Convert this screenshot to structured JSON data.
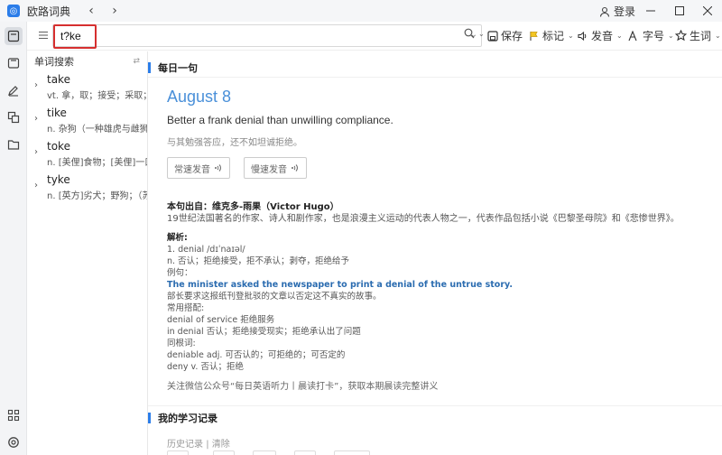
{
  "window": {
    "title": "欧路词典",
    "login": "登录"
  },
  "search": {
    "value": "t?ke",
    "toolbar": {
      "save": "保存",
      "mark": "标记",
      "pronounce": "发音",
      "font": "字号",
      "vocab": "生词"
    }
  },
  "wordlist": {
    "header": "单词搜索",
    "items": [
      {
        "word": "take",
        "def": "vt. 拿，取；接受；采取；吸"
      },
      {
        "word": "tike",
        "def": "n. 杂狗（一种雄虎与雌狮交"
      },
      {
        "word": "toke",
        "def": "n. [美俚]食物；[美俚]一口抽"
      },
      {
        "word": "tyke",
        "def": "n. [英方]劣犬；野狗；（苏"
      }
    ]
  },
  "daily": {
    "section_title": "每日一句",
    "date": "August 8",
    "sentence": "Better a frank denial than unwilling compliance.",
    "translation": "与其勉强答应，还不如坦诚拒绝。",
    "normal_audio": "常速发音",
    "slow_audio": "慢速发音",
    "source": "本句出自：维克多-雨果（Victor Hugo）",
    "bio": "19世纪法国著名的作家、诗人和剧作家，也是浪漫主义运动的代表人物之一，代表作品包括小说《巴黎圣母院》和《悲惨世界》。",
    "analysis_title": "解析:",
    "analysis": [
      "1. denial /dɪˈnaɪəl/",
      "n. 否认；拒绝接受，拒不承认；剥夺，拒绝给予",
      "例句：",
      "The minister asked the newspaper to print a denial of the untrue story.",
      "部长要求这报纸刊登批驳的文章以否定这不真实的故事。",
      "常用搭配:",
      "denial of service 拒绝服务",
      "in denial 否认；拒绝接受现实；拒绝承认出了问题",
      "同根词:",
      "deniable adj. 可否认的；可拒绝的；可否定的",
      "deny v. 否认；拒绝"
    ],
    "notice": "关注微信公众号“每日英语听力丨晨读打卡”，获取本期晨读完整讲义"
  },
  "study": {
    "section_title": "我的学习记录",
    "history": "历史记录",
    "clear": "清除"
  },
  "colors": {
    "accent": "#2b7de9",
    "highlight_box": "#d62f2f",
    "date_blue": "#4a90d9",
    "example_blue": "#2b6cb0"
  }
}
